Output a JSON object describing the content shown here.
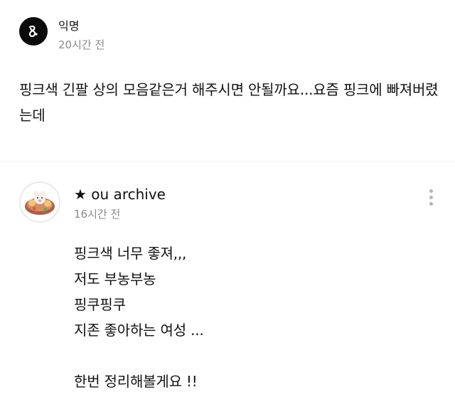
{
  "question": {
    "author": "익명",
    "time": "20시간 전",
    "body": "핑크색 긴팔 상의 모음같은거 해주시면 안될까요...요즘 핑크에 빠져버렸는데",
    "avatar_icon": "anonymous-logo-icon"
  },
  "reply": {
    "author": "★ ou archive",
    "time": "16시간 전",
    "avatar_icon": "character-avatar-icon",
    "more_icon": "more-vertical-icon",
    "lines": [
      "핑크색 너무 좋져,,,",
      "저도 부농부농",
      "핑쿠핑쿠",
      "지존 좋아하는 여성 ...",
      "",
      "한번 정리해볼게요 !!"
    ]
  },
  "colors": {
    "text": "#111111",
    "meta": "#8a8a8a",
    "divider": "#eeeeee",
    "anon_avatar_bg": "#0b0b0b"
  }
}
